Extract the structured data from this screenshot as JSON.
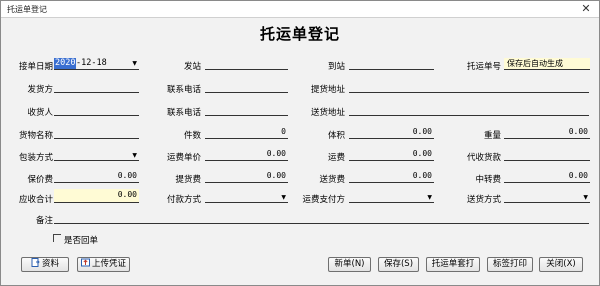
{
  "window": {
    "title": "托运单登记"
  },
  "form": {
    "title": "托运单登记",
    "labels": {
      "date": "接单日期",
      "from_station": "发站",
      "to_station": "到站",
      "waybill_no": "托运单号",
      "shipper": "发货方",
      "shipper_phone": "联系电话",
      "pickup_address": "提货地址",
      "receiver": "收货人",
      "receiver_phone": "联系电话",
      "delivery_address": "送货地址",
      "goods_name": "货物名称",
      "pieces": "件数",
      "volume": "体积",
      "weight": "重量",
      "packing": "包装方式",
      "freight_unit_price": "运费单价",
      "freight": "运费",
      "cod": "代收货款",
      "insurance": "保价费",
      "pickup_fee": "提货费",
      "delivery_fee": "送货费",
      "transfer_fee": "中转费",
      "receivable_total": "应收合计",
      "payment_method": "付款方式",
      "freight_payer": "运费支付方",
      "delivery_method": "送货方式",
      "remark": "备注",
      "return_receipt": "是否回单"
    },
    "values": {
      "date_year": "2020",
      "date_rest": "-12-18",
      "waybill_no": "保存后自动生成",
      "pieces": "0",
      "volume": "0.00",
      "weight": "0.00",
      "freight_unit_price": "0.00",
      "freight": "0.00",
      "insurance": "0.00",
      "pickup_fee": "0.00",
      "delivery_fee": "0.00",
      "transfer_fee": "0.00",
      "receivable_total": "0.00"
    }
  },
  "buttons": {
    "attachments": "资料",
    "upload_voucher": "上传凭证",
    "new": "新单(N)",
    "save": "保存(S)",
    "print_waybill": "托运单套打",
    "print_label": "标签打印",
    "close": "关闭(X)"
  },
  "colors": {
    "selection": "#3a6fd1",
    "highlight_field": "#fffbd5"
  }
}
